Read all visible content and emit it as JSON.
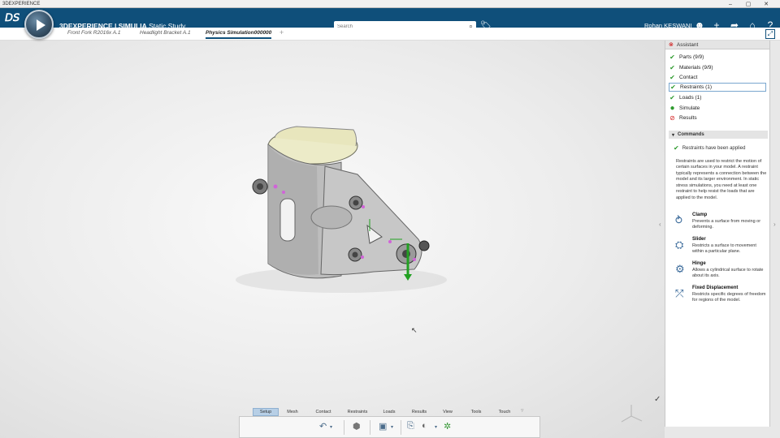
{
  "window": {
    "title": "3DEXPERIENCE",
    "controls": [
      "–",
      "▢",
      "✕"
    ]
  },
  "header": {
    "brand": "3DEXPERIENCE | SIMULIA",
    "app": "Static Study",
    "search_placeholder": "Search",
    "user": "Rohan KESWANI"
  },
  "tabs": [
    {
      "label": "Front Fork R2016x A.1",
      "active": false
    },
    {
      "label": "Headlight Bracket A.1",
      "active": false
    },
    {
      "label": "Physics Simulation000000",
      "active": true
    },
    {
      "label": "+",
      "active": false
    }
  ],
  "assistant": {
    "title": "Assistant",
    "steps": [
      {
        "label": "Parts (9/9)",
        "status": "ok"
      },
      {
        "label": "Materials (9/9)",
        "status": "ok"
      },
      {
        "label": "Contact",
        "status": "ok"
      },
      {
        "label": "Restraints (1)",
        "status": "ok",
        "selected": true
      },
      {
        "label": "Loads (1)",
        "status": "ok"
      },
      {
        "label": "Simulate",
        "status": "pending"
      },
      {
        "label": "Results",
        "status": "blocked"
      }
    ],
    "commands_title": "Commands",
    "applied_message": "Restraints have been applied",
    "description": "Restraints are used to restrict the motion of certain surfaces in your model. A restraint typically represents a connection between the model and its larger environment. In static stress simulations, you need at least one restraint to help resist the loads that are applied to the model.",
    "commands": [
      {
        "name": "Clamp",
        "desc": "Prevents a surface from moving or deforming.",
        "icon": "clamp-icon"
      },
      {
        "name": "Slider",
        "desc": "Restricts a surface to movement within a particular plane.",
        "icon": "slider-icon"
      },
      {
        "name": "Hinge",
        "desc": "Allows a cylindrical surface to rotate about its axis.",
        "icon": "hinge-icon"
      },
      {
        "name": "Fixed Displacement",
        "desc": "Restricts specific degrees of freedom for regions of the model.",
        "icon": "fixed-displacement-icon"
      }
    ]
  },
  "action_bar": {
    "tabs": [
      "Setup",
      "Mesh",
      "Contact",
      "Restraints",
      "Loads",
      "Results",
      "View",
      "Tools",
      "Touch"
    ],
    "active_tab": "Setup"
  },
  "colors": {
    "header": "#0f4f7a",
    "ok": "#2e9b2e",
    "blocked": "#d42020",
    "active_tab": "#b7cfe6"
  }
}
